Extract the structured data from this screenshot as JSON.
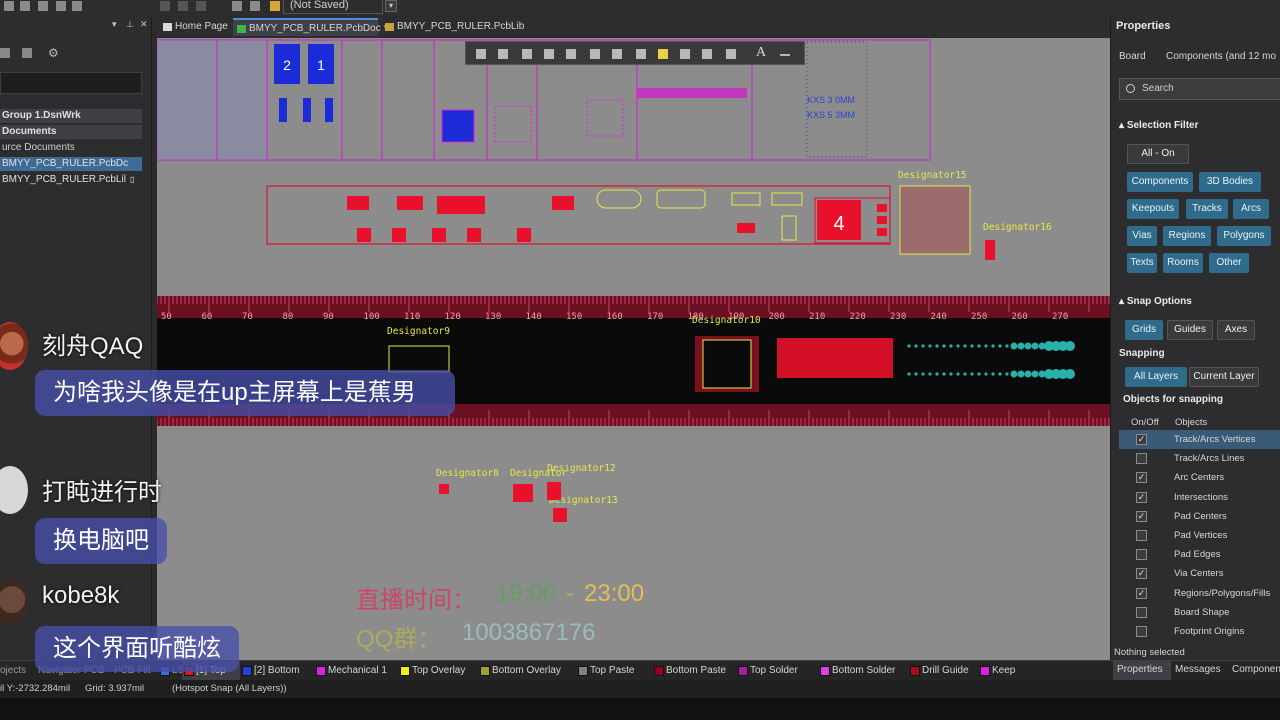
{
  "topbar": {
    "unsaved": "(Not Saved)"
  },
  "left_panel": {
    "workspace": "Group 1.DsnWrk",
    "documents_header": "Documents",
    "source_documents": "urce Documents",
    "pcbdoc": "BMYY_PCB_RULER.PcbDc",
    "pcblib": "BMYY_PCB_RULER.PcbLil"
  },
  "tabs": [
    {
      "label": "Home Page"
    },
    {
      "label": "BMYY_PCB_RULER.PcbDoc *"
    },
    {
      "label": "BMYY_PCB_RULER.PcbLib"
    }
  ],
  "canvas": {
    "designators": {
      "d15": "Designator15",
      "d16": "Designator16",
      "d9": "Designator9",
      "d10": "Designator10",
      "d8": "Designator8",
      "d_mid": "Designator",
      "d12": "Designator12",
      "d13": "Designator13"
    },
    "big_pad_number": "4",
    "pad_numbers": [
      "2",
      "1"
    ],
    "ruler_marks": [
      "50",
      "60",
      "70",
      "80",
      "90",
      "100",
      "110",
      "120",
      "130",
      "140",
      "150",
      "160",
      "170",
      "180",
      "190",
      "200",
      "210",
      "220",
      "230",
      "240",
      "250",
      "260",
      "270"
    ],
    "silk_text": [
      "KXS 3 0MM",
      "KXS 5 3MM"
    ]
  },
  "properties": {
    "title": "Properties",
    "board_label": "Board",
    "components_label": "Components (and 12 mo",
    "search_placeholder": "Search",
    "selection_filter": "Selection Filter",
    "all_on": "All - On",
    "filters": [
      "Components",
      "3D Bodies",
      "Keepouts",
      "Tracks",
      "Arcs",
      "Vias",
      "Regions",
      "Polygons",
      "Texts",
      "Rooms",
      "Other"
    ],
    "snap_options": "Snap Options",
    "snap_tabs": [
      "Grids",
      "Guides",
      "Axes"
    ],
    "snapping": "Snapping",
    "snapping_tabs": [
      "All Layers",
      "Current Layer"
    ],
    "objects_for_snapping": "Objects for snapping",
    "col_onoff": "On/Off",
    "col_objects": "Objects",
    "objects": [
      {
        "name": "Track/Arcs Vertices",
        "on": true
      },
      {
        "name": "Track/Arcs Lines",
        "on": false
      },
      {
        "name": "Arc Centers",
        "on": true
      },
      {
        "name": "Intersections",
        "on": true
      },
      {
        "name": "Pad Centers",
        "on": true
      },
      {
        "name": "Pad Vertices",
        "on": false
      },
      {
        "name": "Pad Edges",
        "on": false
      },
      {
        "name": "Via Centers",
        "on": true
      },
      {
        "name": "Regions/Polygons/Fills",
        "on": true
      },
      {
        "name": "Board Shape",
        "on": false
      },
      {
        "name": "Footprint Origins",
        "on": false
      }
    ],
    "nothing_selected": "Nothing selected"
  },
  "layer_tabs": [
    {
      "label": "ojects",
      "color": ""
    },
    {
      "label": "Navigator",
      "color": ""
    },
    {
      "label": "PCB",
      "color": ""
    },
    {
      "label": "PCB Filt",
      "color": ""
    },
    {
      "label": "LS",
      "color": "#3c6fd8"
    },
    {
      "label": "[1] Top",
      "color": "#e01030"
    },
    {
      "label": "[2] Bottom",
      "color": "#2040e0"
    },
    {
      "label": "Mechanical 1",
      "color": "#e020e0"
    },
    {
      "label": "Top Overlay",
      "color": "#f0f020"
    },
    {
      "label": "Bottom Overlay",
      "color": "#a0a030"
    },
    {
      "label": "Top Paste",
      "color": "#808080"
    },
    {
      "label": "Bottom Paste",
      "color": "#900020"
    },
    {
      "label": "Top Solder",
      "color": "#a020a0"
    },
    {
      "label": "Bottom Solder",
      "color": "#e040e0"
    },
    {
      "label": "Drill Guide",
      "color": "#a01020"
    },
    {
      "label": "Keep",
      "color": "#e020e0"
    }
  ],
  "panel_tabs": [
    "Properties",
    "Messages",
    "Componen"
  ],
  "status": {
    "coords": "il Y:-2732.284mil",
    "grid": "Grid: 3.937mil",
    "snap": "(Hotspot Snap (All Layers))"
  },
  "chat": [
    {
      "user": "刻舟QAQ",
      "message": "为啥我头像是在up主屏幕上是蕉男"
    },
    {
      "user": "打盹进行时",
      "message": "换电脑吧"
    },
    {
      "user": "kobe8k",
      "message": "这个界面听酷炫"
    }
  ],
  "overlay": {
    "live_time_label": "直播时间：",
    "live_time_start": "19:00",
    "live_time_dash": "-",
    "live_time_end": "23:00",
    "qq_label": "QQ群：",
    "qq_number": "1003867176"
  },
  "colors": {
    "pad_red": "#e8102a",
    "silk_yellow": "#e6e64a",
    "canvas_gray": "#8c8c8c",
    "accent_teal": "#2f6b8a"
  }
}
